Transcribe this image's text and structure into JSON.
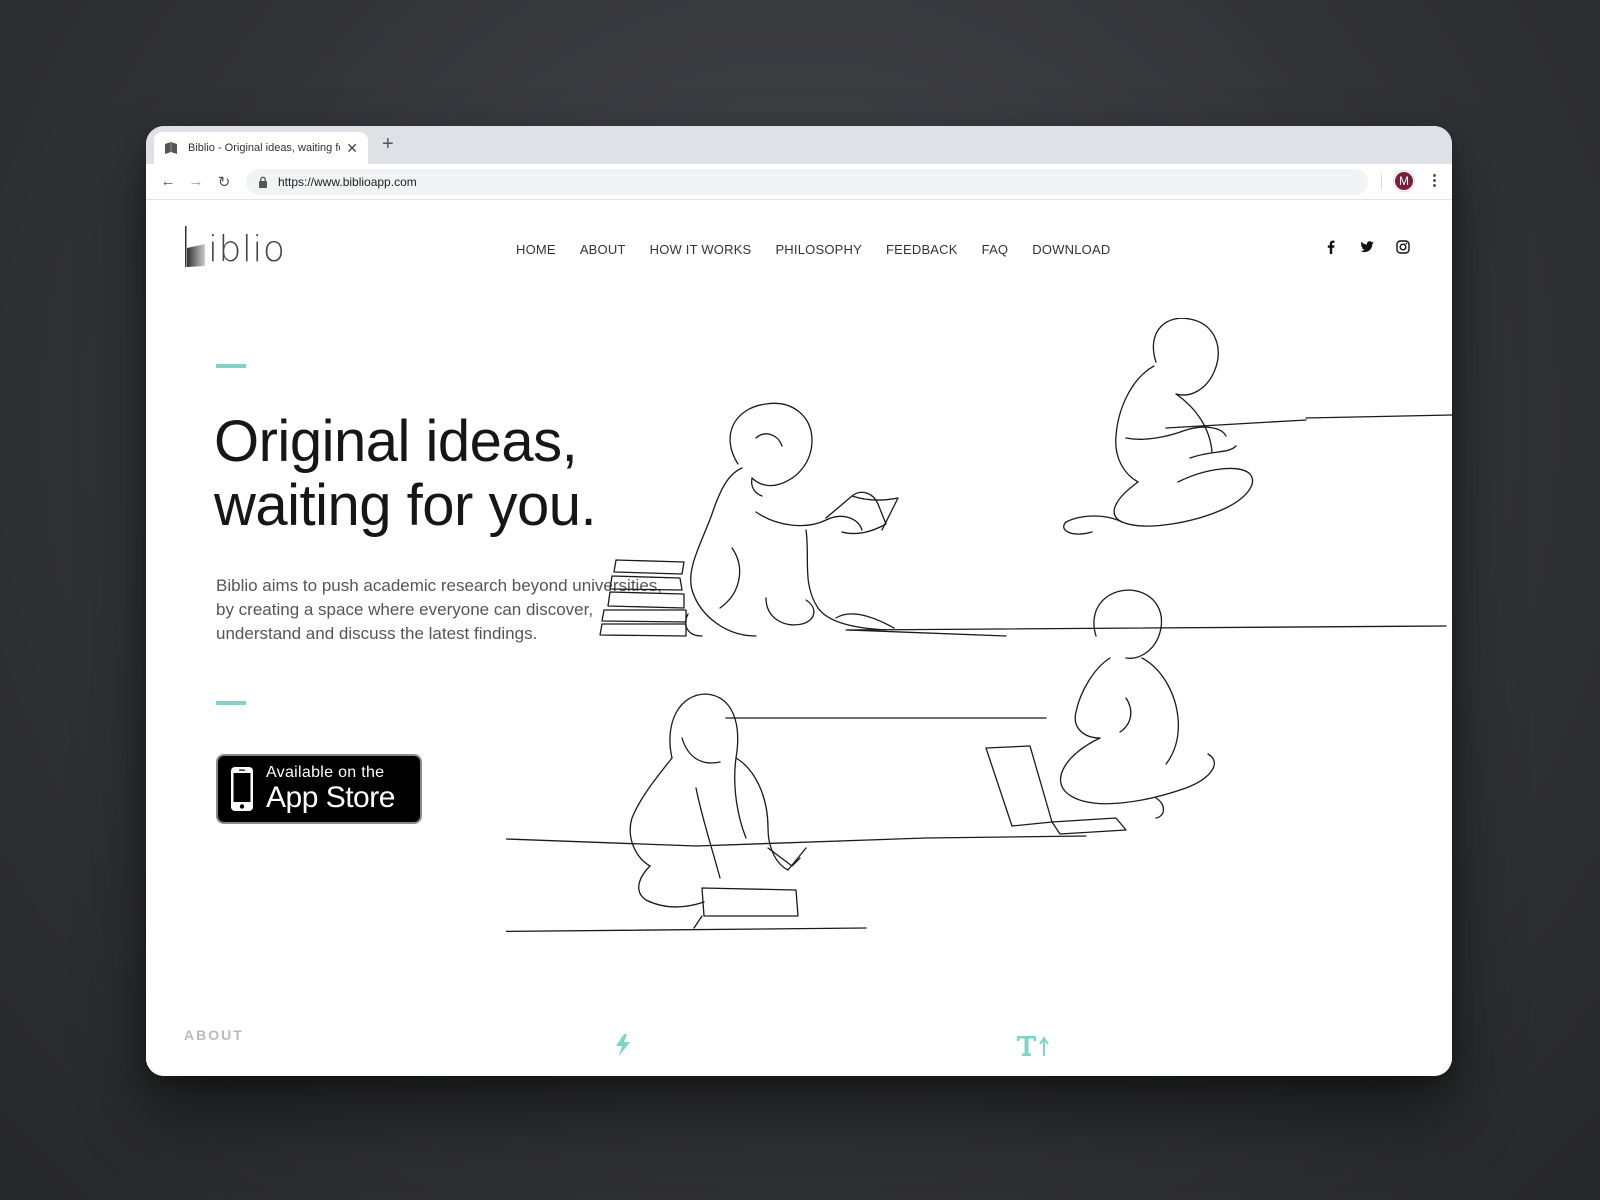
{
  "browser": {
    "tab_title": "Biblio - Original ideas, waiting for you.",
    "url": "https://www.biblioapp.com",
    "profile_initial": "M"
  },
  "header": {
    "logo_text": "iblio",
    "nav": [
      "HOME",
      "ABOUT",
      "HOW IT WORKS",
      "PHILOSOPHY",
      "FEEDBACK",
      "FAQ",
      "DOWNLOAD"
    ],
    "social_icons": [
      "facebook-icon",
      "twitter-icon",
      "instagram-icon"
    ]
  },
  "hero": {
    "title_line1": "Original ideas,",
    "title_line2": "waiting for you.",
    "description": "Biblio aims to push academic research beyond universities, by creating a space where everyone can discover, understand and discuss the latest findings.",
    "appstore_small": "Available on the",
    "appstore_big": "App Store"
  },
  "about": {
    "label": "ABOUT",
    "feature_icons": [
      "lightning-icon",
      "text-size-icon"
    ]
  },
  "colors": {
    "accent": "#7ed4c7",
    "profile": "#7b1e3e",
    "text_dark": "#161616"
  }
}
